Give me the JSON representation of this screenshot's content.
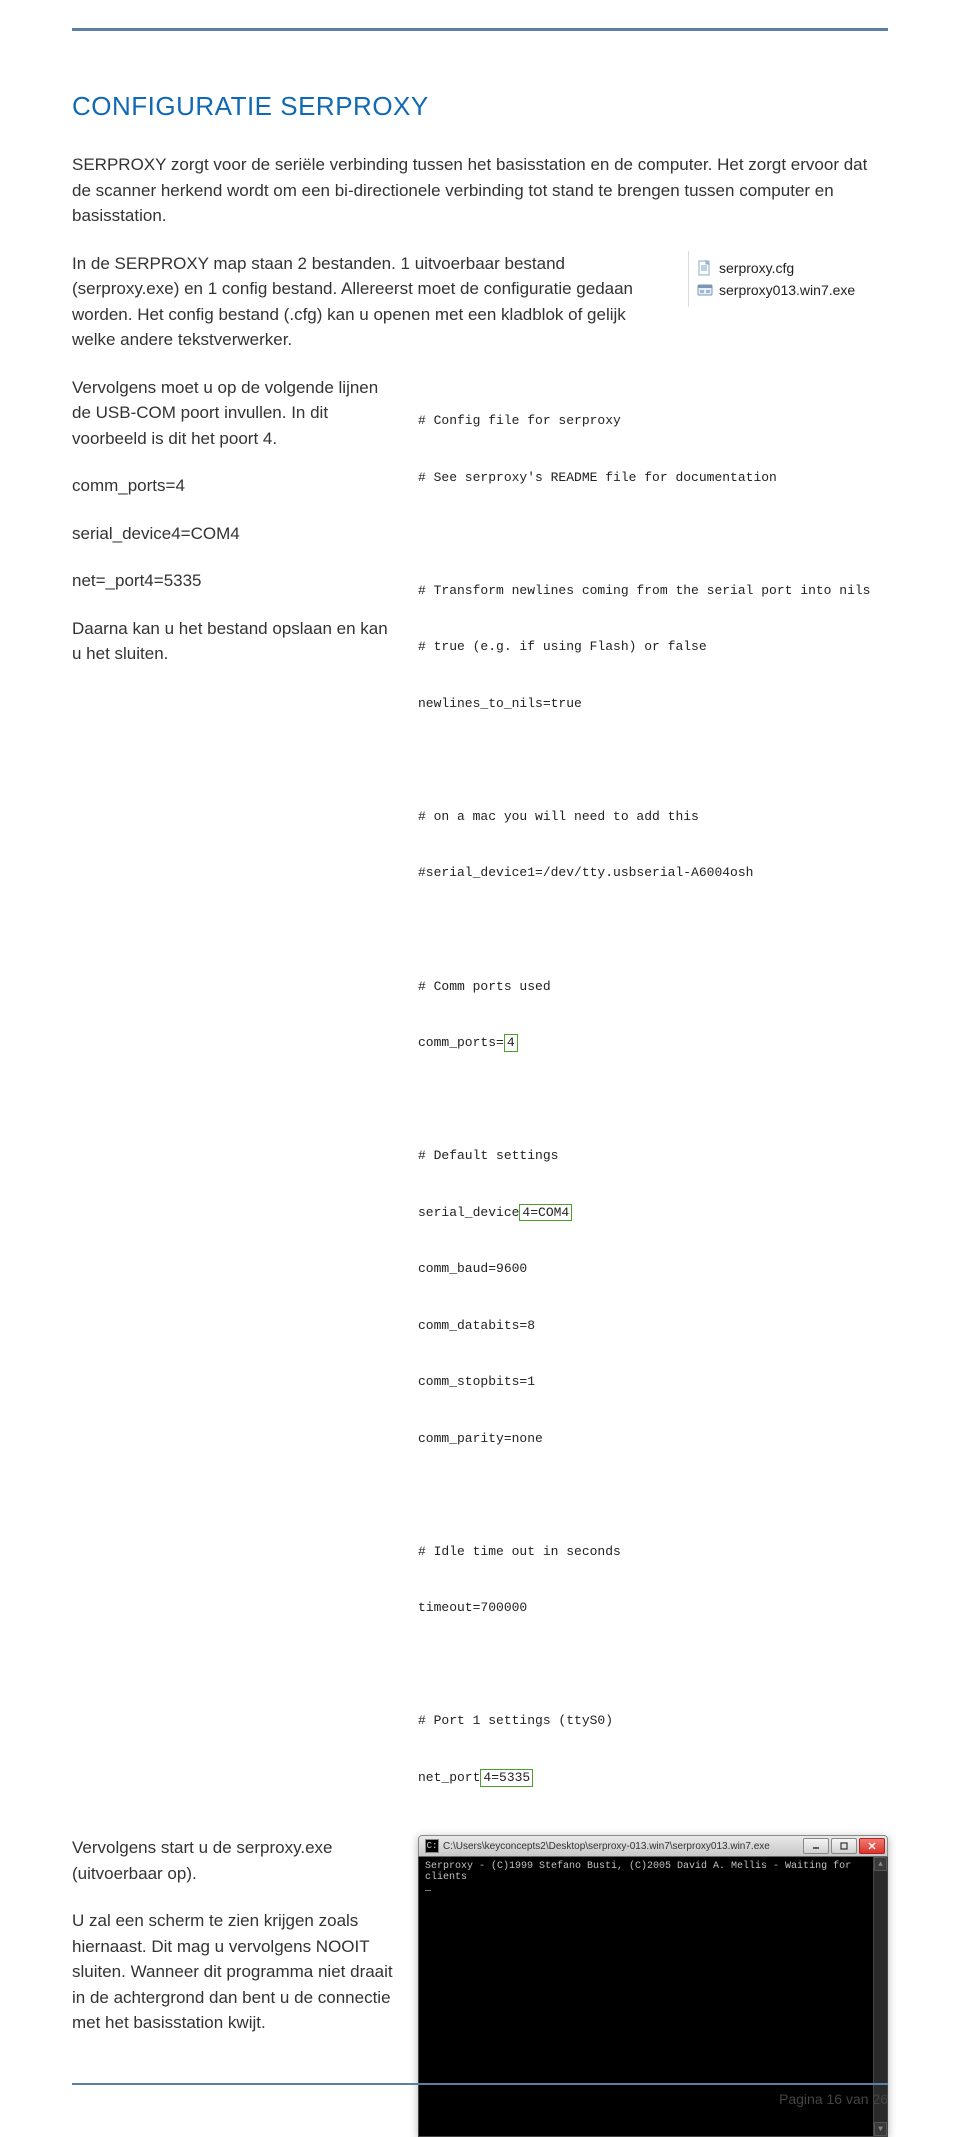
{
  "title": "CONFIGURATIE SERPROXY",
  "intro1": "SERPROXY zorgt voor de seriële verbinding tussen het basisstation en de computer. Het zorgt ervoor dat de scanner herkend wordt om een bi-directionele verbinding tot stand te brengen tussen computer en basisstation.",
  "intro2": "In de SERPROXY map staan 2 bestanden. 1 uitvoerbaar bestand (serproxy.exe) en 1 config bestand. Allereerst moet de configuratie gedaan worden. Het config bestand (.cfg) kan u openen met een kladblok of gelijk welke andere tekstverwerker.",
  "para3": "Vervolgens moet u op de volgende lijnen de USB-COM poort invullen. In dit voorbeeld is dit het poort 4.",
  "set1": "comm_ports=4",
  "set2": "serial_device4=COM4",
  "set3": "net=_port4=5335",
  "para4": "Daarna kan u het bestand opslaan en kan u het sluiten.",
  "para5": "Vervolgens start u de serproxy.exe (uitvoerbaar op).",
  "para6": "U zal een scherm te zien krijgen zoals hiernaast. Dit mag u vervolgens NOOIT sluiten. Wanneer dit programma niet draait in de achtergrond dan bent u de connectie met het basisstation kwijt.",
  "files": {
    "cfg": "serproxy.cfg",
    "exe": "serproxy013.win7.exe"
  },
  "cfg": {
    "l1": "# Config file for serproxy",
    "l2": "# See serproxy's README file for documentation",
    "l3": "# Transform newlines coming from the serial port into nils",
    "l4": "# true (e.g. if using Flash) or false",
    "l5": "newlines_to_nils=true",
    "l6": "# on a mac you will need to add this",
    "l7": "#serial_device1=/dev/tty.usbserial-A6004osh",
    "l8": "# Comm ports used",
    "l9a": "comm_ports=",
    "l9b": "4",
    "l10": "# Default settings",
    "l11a": "serial_device",
    "l11b": "4=COM4",
    "l12": "comm_baud=9600",
    "l13": "comm_databits=8",
    "l14": "comm_stopbits=1",
    "l15": "comm_parity=none",
    "l16": "# Idle time out in seconds",
    "l17": "timeout=700000",
    "l18": "# Port 1 settings (ttyS0)",
    "l19a": "net_port",
    "l19b": "4=5335"
  },
  "cmd": {
    "title": "C:\\Users\\keyconcepts2\\Desktop\\serproxy-013.win7\\serproxy013.win7.exe",
    "line": "Serproxy - (C)1999 Stefano Busti, (C)2005 David A. Mellis - Waiting for clients",
    "cursor": "_"
  },
  "footer": "Pagina 16 van 26"
}
